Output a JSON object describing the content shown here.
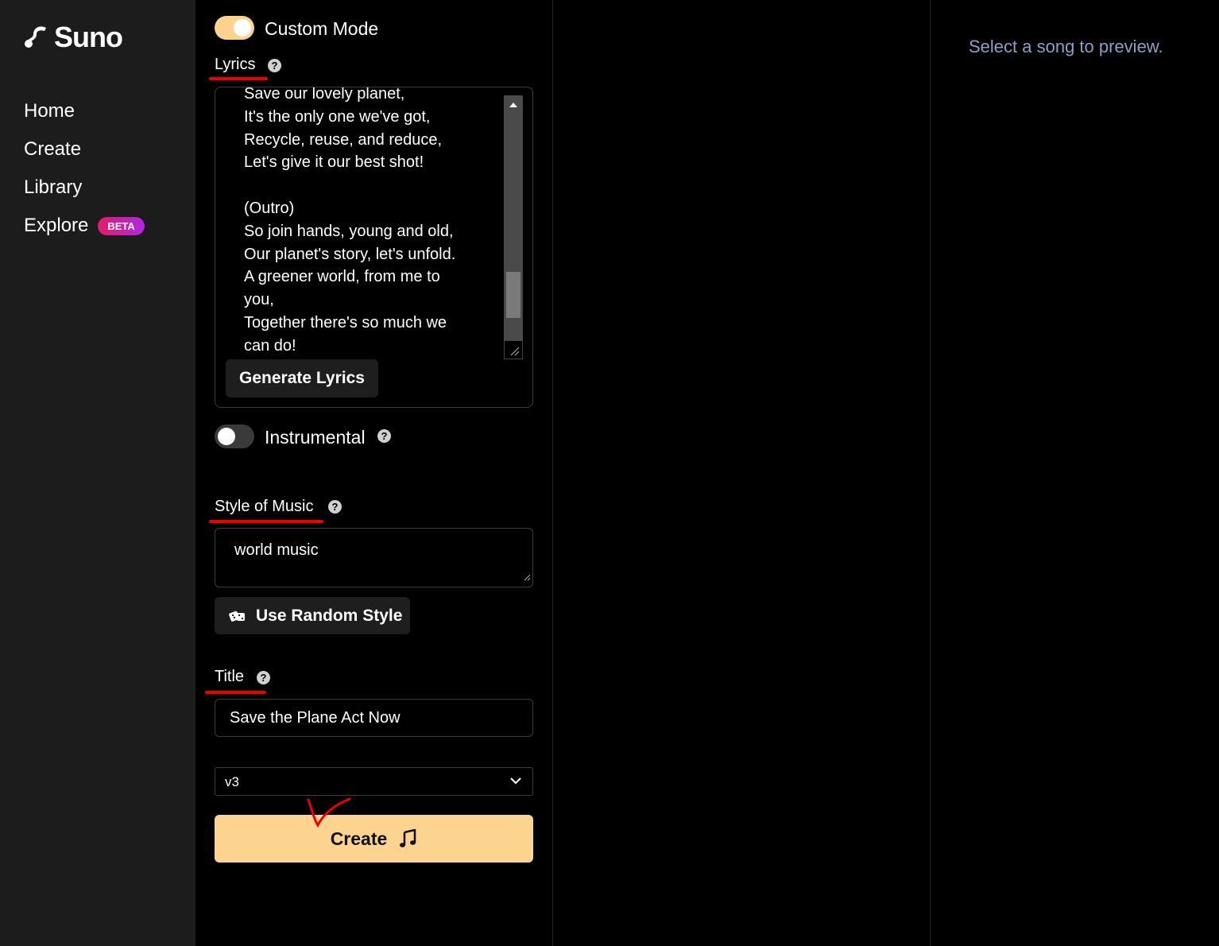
{
  "app": {
    "logo_text": "Suno"
  },
  "sidebar": {
    "items": [
      {
        "label": "Home"
      },
      {
        "label": "Create"
      },
      {
        "label": "Library"
      },
      {
        "label": "Explore",
        "badge": "BETA"
      }
    ]
  },
  "form": {
    "custom_mode_label": "Custom Mode",
    "custom_mode_on": true,
    "lyrics_label": "Lyrics",
    "lyrics_lines": [
      "Save our lovely planet,",
      "It's the only one we've got,",
      "Recycle, reuse, and reduce,",
      "Let's give it our best shot!",
      "",
      "(Outro)",
      "So join hands, young and old,",
      "Our planet's story, let's unfold.",
      "A greener world, from me to",
      "you,",
      "Together there's so much we",
      "can do!"
    ],
    "generate_lyrics_label": "Generate Lyrics",
    "instrumental_label": "Instrumental",
    "instrumental_on": false,
    "style_label": "Style of Music",
    "style_value": "world music",
    "random_style_label": "Use Random Style",
    "title_label": "Title",
    "title_value": "Save the Plane Act Now",
    "model_value": "v3",
    "create_label": "Create"
  },
  "preview": {
    "placeholder": "Select a song to preview."
  },
  "colors": {
    "accent": "#fcd38f",
    "annotation": "#e00000",
    "beta_gradient_start": "#e11d6a",
    "beta_gradient_end": "#b026e6"
  },
  "icons": [
    "suno-logo-icon",
    "help-icon",
    "dice-icon",
    "chevron-down-icon",
    "music-note-icon",
    "checkmark-annotation"
  ]
}
